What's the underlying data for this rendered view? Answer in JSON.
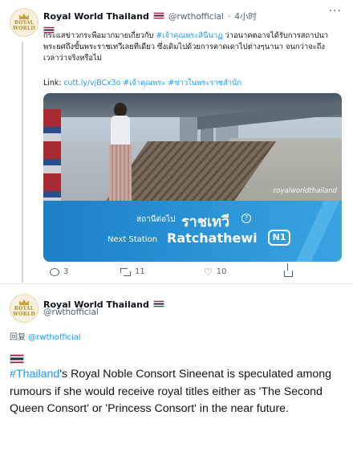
{
  "tweet1": {
    "author_name": "Royal World Thailand",
    "flag_icon": "thai-flag-icon",
    "handle": "@rwthofficial",
    "separator": "·",
    "time": "4小时",
    "more_icon": "more-icon",
    "more_label": "···",
    "body_part1": "กระแสข่าวกระพือมากมายเกี่ยวกับ ",
    "body_hashtag": "#เจ้าคุณพระสินีนาฏ",
    "body_part2": " ว่าอนาคตอาจได้รับการสถาปนาพระยศถึงขั้นพระราชเทวีเลยทีเดียว ซึ่งเดิมไปด้วยการคาดเดาไปต่างๆนานา จนกว่าจะถึงเวลาว่าจริงหรือไม่",
    "link_label": "Link:",
    "link_url": "cutt.ly/vjBCx3o",
    "link_tag1": "#เจ้าคุณพระ",
    "link_tag2": "#ข่าวในพระราชสำนัก",
    "media": {
      "watermark": "royalworldthailand",
      "sign_th_small": "สถานีต่อไป",
      "sign_th_big": "ราชเทวี",
      "sign_q": "?",
      "sign_en_small": "Next Station",
      "sign_en_big": "Ratchathewi",
      "sign_code": "N1"
    },
    "actions": {
      "reply_count": "3",
      "retweet_count": "11",
      "like_count": "10",
      "like_icon": "♡"
    }
  },
  "tweet2": {
    "author_name": "Royal World Thailand",
    "handle": "@rwthofficial",
    "reply_prefix": "回复",
    "reply_to": "@rwthofficial",
    "body_hashtag": "#Thailand",
    "body_text": "'s Royal Noble Consort Sineenat is speculated among rumours if she would receive royal titles either as 'The Second Queen Consort' or 'Princess Consort' in the near future."
  },
  "avatar": {
    "line1": "ROYAL",
    "line2": "WORLD"
  },
  "colors": {
    "accent": "#1d9bf0",
    "text": "#0f1419",
    "muted": "#536471",
    "sign_blue": "#2b96d8"
  }
}
